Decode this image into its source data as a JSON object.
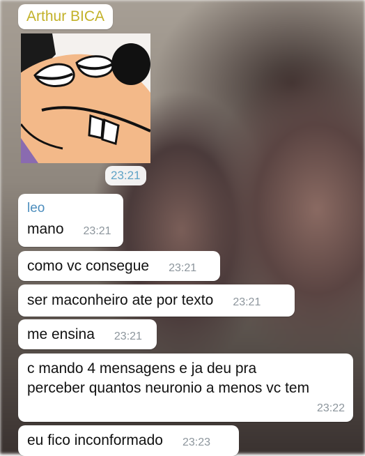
{
  "chat": {
    "sender": "Arthur BICA",
    "sticker": {
      "icon": "goofy-cartoon-sticker",
      "time": "23:21"
    },
    "messages": [
      {
        "text": "mano",
        "time": "23:21",
        "author": "leo"
      },
      {
        "text": "como vc consegue",
        "time": "23:21"
      },
      {
        "text": "ser maconheiro ate por texto",
        "time": "23:21"
      },
      {
        "text": "me ensina",
        "time": "23:21"
      },
      {
        "text": "c mando 4 mensagens e ja deu pra perceber quantos neuronio a menos vc tem",
        "time": "23:22"
      },
      {
        "text": "eu fico inconformado",
        "time": "23:23"
      }
    ]
  },
  "colors": {
    "bubble": "#ffffff",
    "sender_name": "#c3b229",
    "reply_author": "#4c8dbd",
    "timestamp": "#8c959c"
  }
}
